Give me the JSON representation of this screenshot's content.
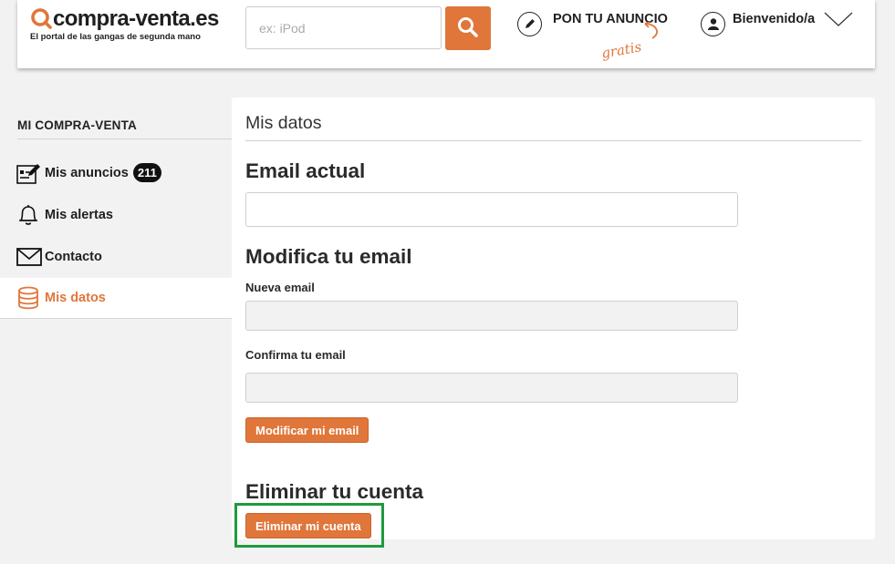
{
  "header": {
    "logo_text": "compra-venta.es",
    "logo_tagline": "El portal de las gangas de segunda mano",
    "search_placeholder": "ex: iPod",
    "post_ad_label": "PON TU ANUNCIO",
    "post_ad_note": "gratis",
    "user_label": "Bienvenido/a"
  },
  "sidebar": {
    "title": "MI COMPRA-VENTA",
    "items": [
      {
        "label": "Mis anuncios",
        "icon": "edit-list-icon",
        "badge": "211"
      },
      {
        "label": "Mis alertas",
        "icon": "bell-icon"
      },
      {
        "label": "Contacto",
        "icon": "envelope-icon"
      },
      {
        "label": "Mis datos",
        "icon": "database-icon",
        "active": true
      }
    ]
  },
  "main": {
    "title": "Mis datos",
    "current_email": {
      "heading": "Email actual",
      "value": ""
    },
    "modify_email": {
      "heading": "Modifica tu email",
      "new_email_label": "Nueva email",
      "new_email_value": "",
      "confirm_email_label": "Confirma tu email",
      "confirm_email_value": "",
      "submit_label": "Modificar mi email"
    },
    "delete_account": {
      "heading": "Eliminar tu cuenta",
      "button_label": "Eliminar mi cuenta"
    }
  },
  "colors": {
    "accent": "#e0763a",
    "highlight": "#1e9a3c",
    "page_bg": "#f2f2f2"
  }
}
